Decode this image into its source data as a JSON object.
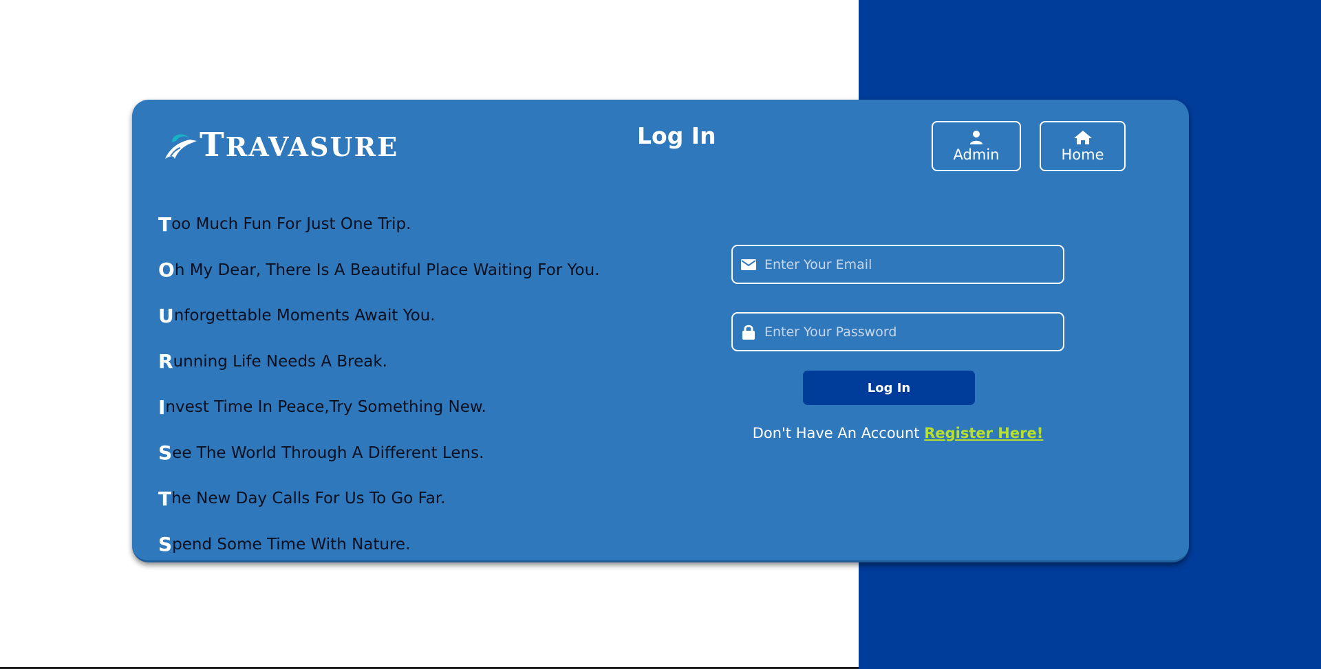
{
  "brand": {
    "logo_initial": "T",
    "logo_rest": "RAVASURE"
  },
  "title": "Log In",
  "nav": {
    "admin_label": "Admin",
    "home_label": "Home"
  },
  "quotes": [
    {
      "initial": "T",
      "rest": "oo Much Fun For Just One Trip."
    },
    {
      "initial": "O",
      "rest": "h My Dear, There Is A Beautiful Place Waiting For You."
    },
    {
      "initial": "U",
      "rest": "nforgettable Moments Await You."
    },
    {
      "initial": "R",
      "rest": "unning Life Needs A Break."
    },
    {
      "initial": "I",
      "rest": "nvest Time In Peace,Try Something New."
    },
    {
      "initial": "S",
      "rest": "ee The World Through A Different Lens."
    },
    {
      "initial": "T",
      "rest": "he New Day Calls For Us To Go Far."
    },
    {
      "initial": "S",
      "rest": "pend Some Time With Nature."
    }
  ],
  "form": {
    "email_placeholder": "Enter Your Email",
    "email_value": "",
    "password_placeholder": "Enter Your Password",
    "password_value": "",
    "submit_label": "Log In",
    "register_prompt": "Don't Have An Account",
    "register_link": "Register Here!"
  },
  "icons": {
    "logo": "bird-logo-icon",
    "admin": "user-icon",
    "home": "home-icon",
    "email": "envelope-icon",
    "password": "lock-icon"
  },
  "colors": {
    "page_right": "#003c99",
    "card": "#2f78bc",
    "button": "#003c99",
    "link": "#b8e02a"
  }
}
